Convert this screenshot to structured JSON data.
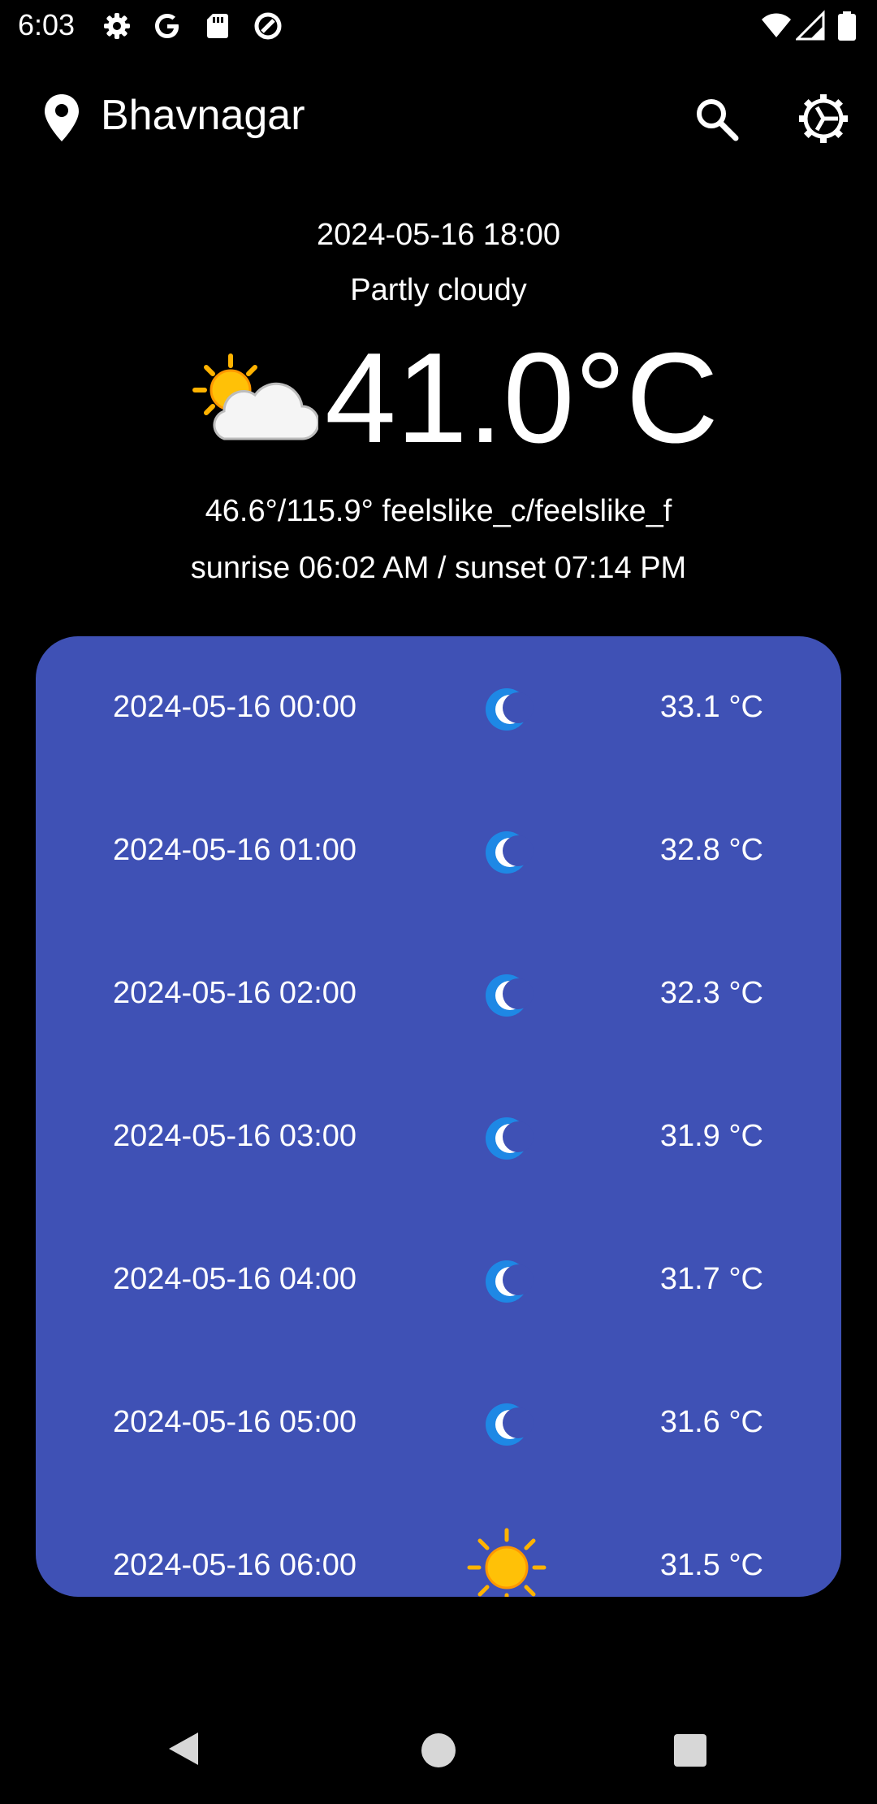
{
  "status_bar": {
    "time": "6:03",
    "icons": [
      "settings-gear-icon",
      "google-g-icon",
      "sd-card-icon",
      "data-saver-icon",
      "wifi-icon",
      "cellular-signal-icon",
      "battery-icon"
    ]
  },
  "header": {
    "city": "Bhavnagar",
    "location_icon": "location-pin-icon",
    "search_icon": "search-icon",
    "settings_icon": "settings-cog-icon"
  },
  "current": {
    "datetime": "2024-05-16 18:00",
    "condition": "Partly cloudy",
    "icon": "partly-cloudy-icon",
    "temperature": "41.0°C",
    "feels_like": "46.6°/115.9° feelslike_c/feelslike_f",
    "sun_times": "sunrise 06:02 AM / sunset 07:14 PM"
  },
  "forecast": {
    "rows": [
      {
        "time": "2024-05-16 00:00",
        "icon": "moon-icon",
        "temp": "33.1 °C"
      },
      {
        "time": "2024-05-16 01:00",
        "icon": "moon-icon",
        "temp": "32.8 °C"
      },
      {
        "time": "2024-05-16 02:00",
        "icon": "moon-icon",
        "temp": "32.3 °C"
      },
      {
        "time": "2024-05-16 03:00",
        "icon": "moon-icon",
        "temp": "31.9 °C"
      },
      {
        "time": "2024-05-16 04:00",
        "icon": "moon-icon",
        "temp": "31.7 °C"
      },
      {
        "time": "2024-05-16 05:00",
        "icon": "moon-icon",
        "temp": "31.6 °C"
      },
      {
        "time": "2024-05-16 06:00",
        "icon": "sun-icon",
        "temp": "31.5 °C"
      }
    ]
  },
  "colors": {
    "background": "#000000",
    "card": "#3f51b5",
    "text": "#ffffff",
    "moon": "#1e88e5",
    "sun": "#ffc107"
  },
  "nav_bar": {
    "back": "back-triangle-icon",
    "home": "home-circle-icon",
    "recents": "recents-square-icon"
  }
}
